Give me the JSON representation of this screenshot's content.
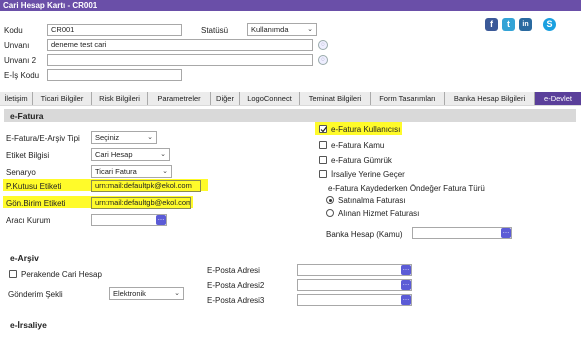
{
  "window": {
    "title": "Cari Hesap Kartı - CR001"
  },
  "header": {
    "kodu_label": "Kodu",
    "kodu_value": "CR001",
    "statusu_label": "Statüsü",
    "statusu_value": "Kullanımda",
    "unvani_label": "Unvanı",
    "unvani_value": "deneme test cari",
    "unvani2_label": "Unvanı 2",
    "unvani2_value": "",
    "eis_label": "E-İş Kodu",
    "eis_value": ""
  },
  "social": {
    "facebook": "f",
    "twitter": "t",
    "linkedin": "in",
    "skype": "S"
  },
  "tabs": [
    {
      "label": "İletişim"
    },
    {
      "label": "Ticari Bilgiler"
    },
    {
      "label": "Risk Bilgileri"
    },
    {
      "label": "Parametreler"
    },
    {
      "label": "Diğer"
    },
    {
      "label": "LogoConnect"
    },
    {
      "label": "Teminat Bilgileri"
    },
    {
      "label": "Form Tasarımları"
    },
    {
      "label": "Banka Hesap Bilgileri"
    },
    {
      "label": "e-Devlet"
    }
  ],
  "efatura": {
    "section_title": "e-Fatura",
    "tipi_label": "E-Fatura/E-Arşiv Tipi",
    "tipi_value": "Seçiniz",
    "etiket_label": "Etiket Bilgisi",
    "etiket_value": "Cari Hesap",
    "senaryo_label": "Senaryo",
    "senaryo_value": "Ticari Fatura",
    "pk_label": "P.Kutusu Etiketi",
    "pk_value": "urn:mail:defaultpk@ekol.com",
    "gb_label": "Gön.Birim Etiketi",
    "gb_value": "urn:mail:defaultgb@ekol.com",
    "araci_label": "Aracı Kurum",
    "araci_value": "",
    "kullanici_label": "e-Fatura Kullanıcısı",
    "kamu_label": "e-Fatura Kamu",
    "gumruk_label": "e-Fatura Gümrük",
    "irsaliye_label": "İrsaliye Yerine Geçer",
    "kaydeder_label": "e-Fatura Kaydederken Öndeğer Fatura Türü",
    "satinalma_label": "Satınalma Faturası",
    "alinan_label": "Alınan Hizmet Faturası",
    "banka_label": "Banka Hesap (Kamu)",
    "banka_value": ""
  },
  "earsiv": {
    "section_title": "e-Arşiv",
    "perakende_label": "Perakende Cari Hesap",
    "gonderim_label": "Gönderim Şekli",
    "gonderim_value": "Elektronik",
    "eposta1_label": "E-Posta Adresi",
    "eposta2_label": "E-Posta Adresi2",
    "eposta3_label": "E-Posta Adresi3"
  },
  "eirsaliye": {
    "section_title": "e-İrsaliye"
  },
  "colors": {
    "titlebar": "#6a4fa8",
    "active_tab": "#5a3f9a",
    "highlight": "#fffb2a"
  }
}
